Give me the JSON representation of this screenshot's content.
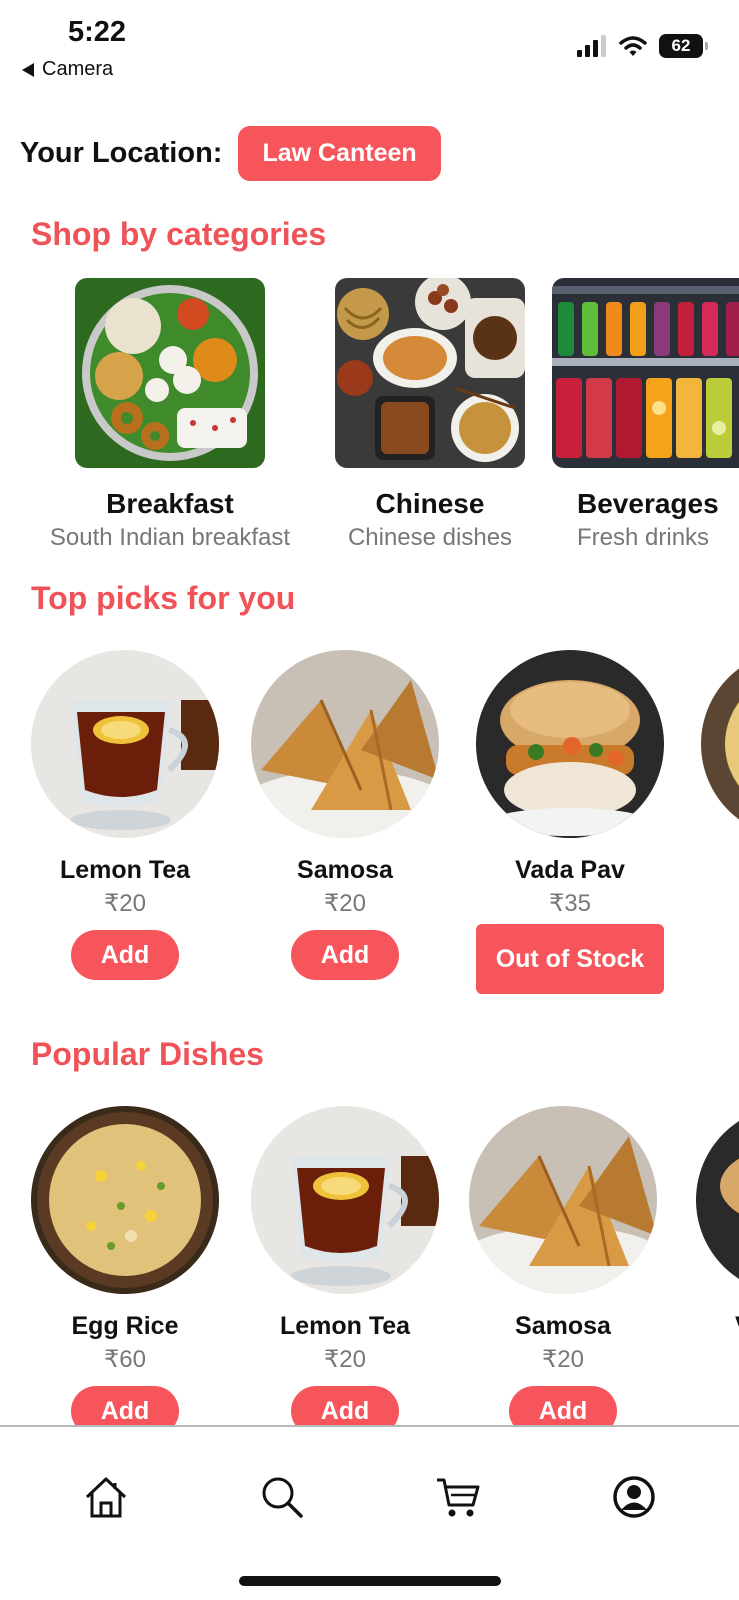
{
  "status_bar": {
    "time": "5:22",
    "back_label": "Camera",
    "battery": "62"
  },
  "location": {
    "label": "Your Location:",
    "value": "Law Canteen"
  },
  "sections": {
    "categories_title": "Shop by categories",
    "top_picks_title": "Top picks for you",
    "popular_title": "Popular Dishes"
  },
  "categories": [
    {
      "name": "Breakfast",
      "subtitle": "South Indian breakfast"
    },
    {
      "name": "Chinese",
      "subtitle": "Chinese dishes"
    },
    {
      "name": "Beverages",
      "subtitle": "Fresh drinks"
    }
  ],
  "top_picks": [
    {
      "name": "Lemon Tea",
      "price": "₹20",
      "action": "Add"
    },
    {
      "name": "Samosa",
      "price": "₹20",
      "action": "Add"
    },
    {
      "name": "Vada Pav",
      "price": "₹35",
      "action": "Out of Stock"
    }
  ],
  "popular": [
    {
      "name": "Egg Rice",
      "price": "₹60",
      "action": "Add"
    },
    {
      "name": "Lemon Tea",
      "price": "₹20",
      "action": "Add"
    },
    {
      "name": "Samosa",
      "price": "₹20",
      "action": "Add"
    },
    {
      "name": "V",
      "action": "Ou"
    }
  ],
  "colors": {
    "accent": "#f6555b",
    "title": "#ef5257"
  },
  "tabs": [
    "home-icon",
    "search-icon",
    "cart-icon",
    "profile-icon"
  ]
}
